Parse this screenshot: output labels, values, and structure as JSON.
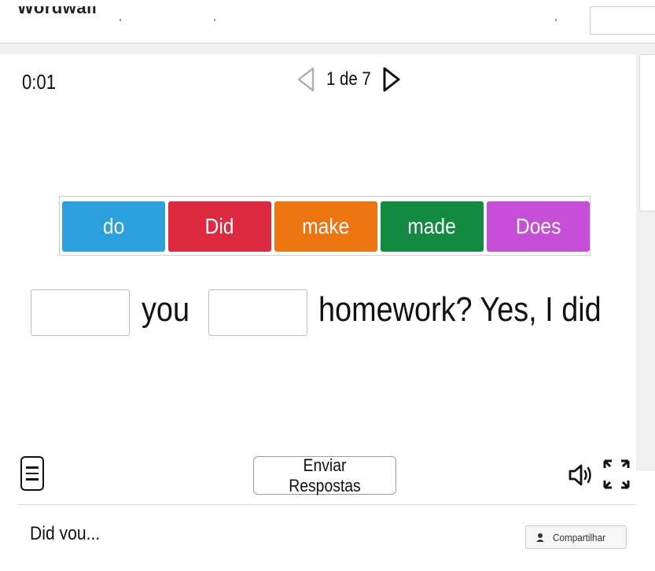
{
  "header": {
    "brand": "Wordwall"
  },
  "game": {
    "timer": "0:01",
    "pager": {
      "current": "1",
      "separator": "de",
      "total": "7",
      "text": "1 de 7"
    },
    "word_bank": [
      {
        "label": "do",
        "color": "#2aa0dc"
      },
      {
        "label": "Did",
        "color": "#dd2a41"
      },
      {
        "label": "make",
        "color": "#ee7410"
      },
      {
        "label": "made",
        "color": "#128a3f"
      },
      {
        "label": "Does",
        "color": "#c64fd7"
      }
    ],
    "sentence": {
      "word1": "you",
      "word2": "homework? Yes, I did"
    },
    "submit_label": "Enviar Respostas"
  },
  "footer": {
    "activity_title": "Did you...",
    "share_label": "Compartilhar"
  }
}
